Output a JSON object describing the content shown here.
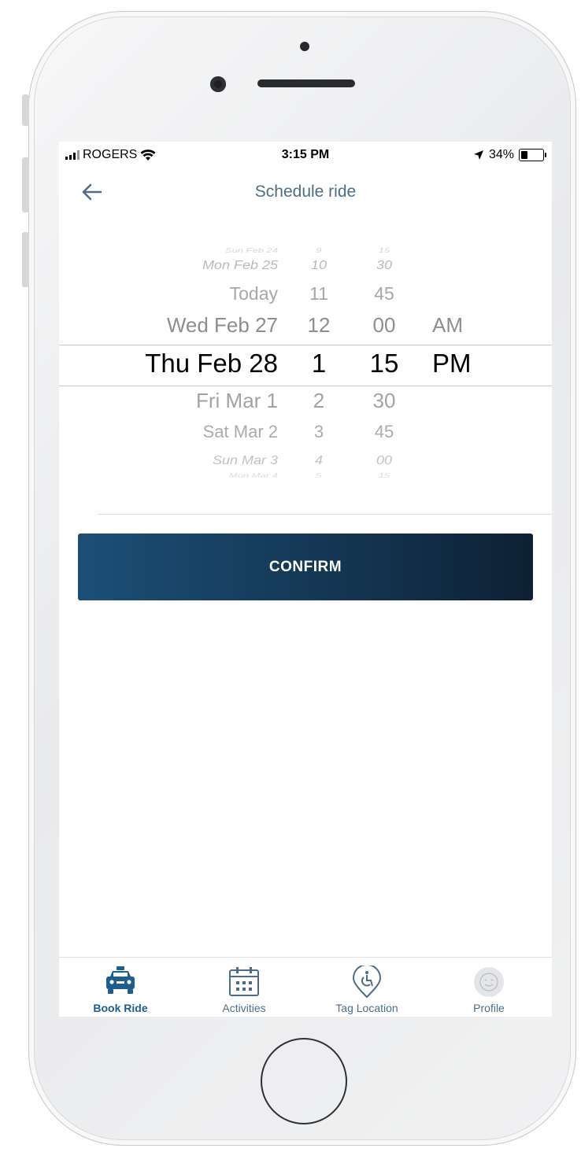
{
  "status_bar": {
    "carrier": "ROGERS",
    "time": "3:15 PM",
    "battery": "34%",
    "battery_level": 0.34
  },
  "header": {
    "title": "Schedule ride"
  },
  "picker": {
    "dates": [
      "Sun Feb 24",
      "Mon Feb 25",
      "Today",
      "Wed Feb 27",
      "Thu Feb 28",
      "Fri Mar 1",
      "Sat Mar 2",
      "Sun Mar 3",
      "Mon Mar 4"
    ],
    "hours": [
      "9",
      "10",
      "11",
      "12",
      "1",
      "2",
      "3",
      "4",
      "5"
    ],
    "minutes": [
      "15",
      "30",
      "45",
      "00",
      "15",
      "30",
      "45",
      "00",
      "15"
    ],
    "ampm": [
      "AM",
      "PM"
    ],
    "selected": {
      "date": "Thu Feb 28",
      "hour": "1",
      "minute": "15",
      "ampm": "PM"
    }
  },
  "confirm_label": "CONFIRM",
  "tabs": [
    {
      "label": "Book Ride",
      "icon": "taxi-icon",
      "active": true
    },
    {
      "label": "Activities",
      "icon": "calendar-icon",
      "active": false
    },
    {
      "label": "Tag Location",
      "icon": "accessibility-location-pin-icon",
      "active": false
    },
    {
      "label": "Profile",
      "icon": "smiley-avatar-icon",
      "active": false
    }
  ],
  "colors": {
    "accent": "#4c6d8a",
    "active_tab": "#1d5d8f",
    "button_start": "#1c4f77",
    "button_end": "#0e2033"
  }
}
